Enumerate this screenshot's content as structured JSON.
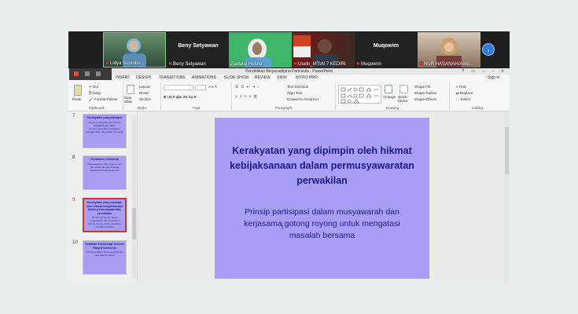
{
  "video": {
    "participants": [
      {
        "caption": "Lidya Suprobo",
        "big_name": ""
      },
      {
        "caption": "Beny Setyawan",
        "big_name": "Beny Setyawan"
      },
      {
        "caption": "Ziadatul Husna",
        "big_name": ""
      },
      {
        "caption": "Usein_MTsN 7 KEDIRI",
        "big_name": ""
      },
      {
        "caption": "Muqowim",
        "big_name": "Muqowim"
      },
      {
        "caption": "NUR HASANAH/Amb...",
        "big_name": ""
      }
    ],
    "next_icon": "chevron-right-icon"
  },
  "ppt": {
    "window_title": "Pendidikan Berparadigma Pancasila - PowerPoint",
    "window_controls": "? ▭ – ▫ ✕",
    "menu": [
      "INSERT",
      "DESIGN",
      "TRANSITIONS",
      "ANIMATIONS",
      "SLIDE SHOW",
      "REVIEW",
      "VIEW",
      "NITRO PRO"
    ],
    "sign_in": "Sign in",
    "ribbon": {
      "clipboard": {
        "paste": "Paste",
        "cut": "Cut",
        "copy": "Copy",
        "format_painter": "Format Painter",
        "label": "Clipboard"
      },
      "slides": {
        "new_slide": "New Slide",
        "layout": "Layout",
        "reset": "Reset",
        "section": "Section",
        "label": "Slides"
      },
      "font": {
        "label": "Font",
        "buttons": "B I U S abc AV Aa A"
      },
      "paragraph": {
        "label": "Paragraph",
        "text_direction": "Text Direction",
        "align_text": "Align Text",
        "smartart": "Convert to SmartArt"
      },
      "drawing": {
        "label": "Drawing",
        "arrange": "Arrange",
        "quick_styles": "Quick Styles",
        "shape_fill": "Shape Fill",
        "shape_outline": "Shape Outline",
        "shape_effects": "Shape Effects"
      },
      "editing": {
        "label": "Editing",
        "find": "Find",
        "replace": "Replace",
        "select": "Select"
      }
    }
  },
  "thumbnails": [
    {
      "num": "7",
      "title": "Kerakyatan yang dipimpin",
      "body": "Prinsip kerakyatan dan hikmah kebijaksanaan dalam permusyawaratan perwakilan sebagai dasar demokrasi Pancasila"
    },
    {
      "num": "8",
      "title": "Pluralisme Indonesia",
      "body": "Keberagaman suku, agama, ras dan antargolongan sebagai kekayaan bangsa Indonesia"
    },
    {
      "num": "9",
      "title": "Kerakyatan yang dipimpin oleh hikmat kebijaksanaan dalam permusyawaratan perwakilan",
      "body": "Prinsip partisipasi dalam musyawarah dan kerjasama gotong royong untuk mengatasi masalah bersama",
      "selected": true
    },
    {
      "num": "10",
      "title": "Keadilan Sosial bagi Seluruh Rakyat Indonesia",
      "body": "Prinsip keadilan dan kesejahteraan bagi seluruh rakyat"
    }
  ],
  "slide": {
    "title": "Kerakyatan yang dipimpin oleh hikmat kebijaksanaan dalam permusyawaratan perwakilan",
    "body": "Prinsip partisipasi dalam musyawarah dan kerjasama gotong royong untuk mengatasi masalah bersama"
  },
  "colors": {
    "slide_bg": "#a89ef5",
    "slide_text": "#1a1a86",
    "selected_thumb": "#c43b28",
    "zoom_button": "#2d7be0"
  }
}
